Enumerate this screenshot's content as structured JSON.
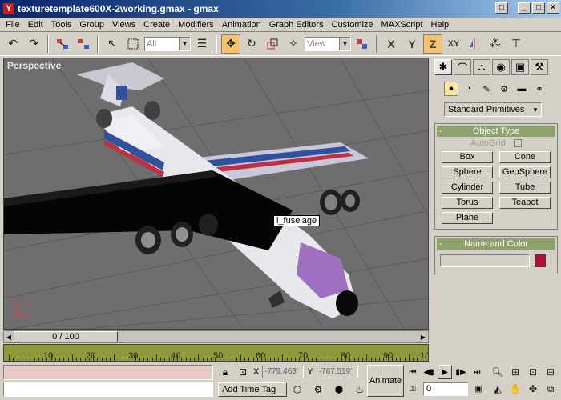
{
  "window": {
    "title": "texturetemplate600X-2working.gmax - gmax",
    "app_icon": "gmax-logo-icon",
    "buttons": [
      "_",
      "□",
      "×"
    ]
  },
  "menu": [
    "File",
    "Edit",
    "Tools",
    "Group",
    "Views",
    "Create",
    "Modifiers",
    "Animation",
    "Graph Editors",
    "Customize",
    "MAXScript",
    "Help"
  ],
  "toolbar": {
    "selection_filter": "All",
    "reference_coord": "View",
    "axis": {
      "x": "X",
      "y": "Y",
      "z": "Z",
      "xy": "XY"
    },
    "active_tool": "move-icon",
    "active_axis": "Z"
  },
  "viewport": {
    "label": "Perspective",
    "tooltip": "l_fuselage",
    "bg_color": "#6e6e6e"
  },
  "command_panel": {
    "primitives_dropdown": "Standard Primitives",
    "object_type": {
      "title": "Object Type",
      "autogrid_label": "AutoGrid",
      "buttons": [
        "Box",
        "Cone",
        "Sphere",
        "GeoSphere",
        "Cylinder",
        "Tube",
        "Torus",
        "Teapot",
        "Plane"
      ]
    },
    "name_and_color": {
      "title": "Name and Color",
      "swatch_color": "#b0103a"
    },
    "rollout_minus": "-"
  },
  "timeline": {
    "slider_label": "0 / 100",
    "ticks": [
      "10",
      "20",
      "30",
      "40",
      "50",
      "60",
      "70",
      "80",
      "90",
      "10"
    ],
    "track_color": "#8e9a3a"
  },
  "status": {
    "x_label": "X",
    "x_value": "-779.463'",
    "y_label": "Y",
    "y_value": "-787.519'",
    "add_time_tag": "Add Time Tag",
    "animate": "Animate",
    "current_frame": "0"
  }
}
